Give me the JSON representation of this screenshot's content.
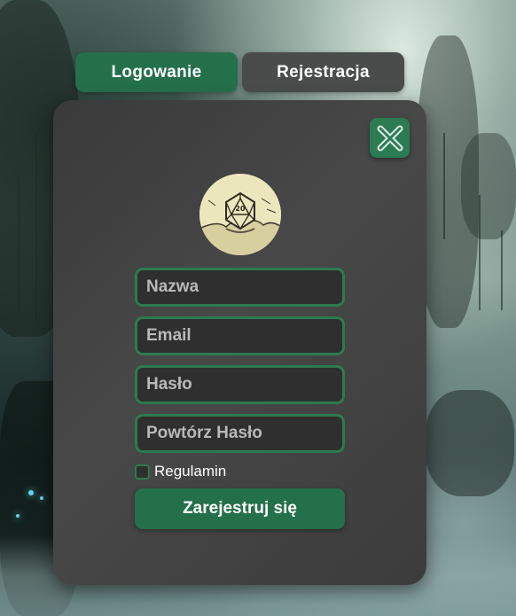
{
  "tabs": {
    "login": "Logowanie",
    "register": "Rejestracja"
  },
  "form": {
    "name_placeholder": "Nazwa",
    "email_placeholder": "Email",
    "password_placeholder": "Hasło",
    "repeat_password_placeholder": "Powtórz Hasło",
    "terms_label": "Regulamin",
    "terms_checked": false,
    "submit_label": "Zarejestruj się"
  },
  "icons": {
    "close": "close-icon",
    "logo": "d20-dice-logo"
  },
  "colors": {
    "accent": "#24704a",
    "card": "#424242",
    "tab_inactive": "#4a4c4b",
    "input_bg": "#2f2f2f"
  }
}
